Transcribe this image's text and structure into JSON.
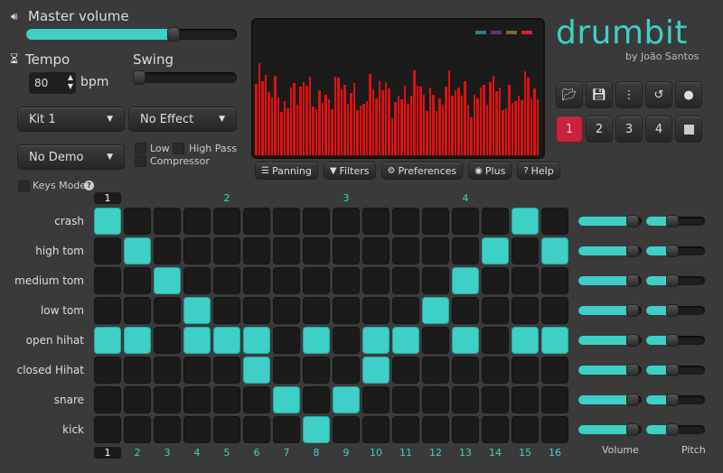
{
  "master_volume": {
    "label": "Master volume",
    "value": 0.7
  },
  "tempo": {
    "label": "Tempo",
    "value": "80",
    "unit": "bpm"
  },
  "swing": {
    "label": "Swing",
    "value": 0
  },
  "kit_select": "Kit 1",
  "effect_select": "No Effect",
  "demo_select": "No Demo",
  "filters": {
    "low": "Low",
    "high_pass": "High Pass",
    "compressor": "Compressor"
  },
  "keys_mode": "Keys Mode",
  "visualizer": {
    "legend_colors": [
      "#2e7d82",
      "#6b2f6b",
      "#6f6f2a",
      "#d42040"
    ],
    "bar_color": "#e01010"
  },
  "toolbar": [
    "Panning",
    "Filters",
    "Preferences",
    "Plus",
    "Help"
  ],
  "logo": {
    "title": "drumbit",
    "byline": "by João Santos"
  },
  "patterns": [
    "1",
    "2",
    "3",
    "4"
  ],
  "active_pattern": 0,
  "beat_markers": [
    "1",
    "2",
    "3",
    "4"
  ],
  "step_numbers": [
    "1",
    "2",
    "3",
    "4",
    "5",
    "6",
    "7",
    "8",
    "9",
    "10",
    "11",
    "12",
    "13",
    "14",
    "15",
    "16"
  ],
  "tracks": [
    {
      "name": "crash",
      "steps": [
        1,
        15
      ],
      "volume": 0.85,
      "pitch": 0.45
    },
    {
      "name": "high tom",
      "steps": [
        2,
        14,
        16
      ],
      "volume": 0.85,
      "pitch": 0.45
    },
    {
      "name": "medium tom",
      "steps": [
        3,
        13
      ],
      "volume": 0.85,
      "pitch": 0.45
    },
    {
      "name": "low tom",
      "steps": [
        4,
        12
      ],
      "volume": 0.85,
      "pitch": 0.45
    },
    {
      "name": "open hihat",
      "steps": [
        1,
        2,
        4,
        5,
        6,
        8,
        10,
        11,
        13,
        15,
        16
      ],
      "volume": 0.85,
      "pitch": 0.45
    },
    {
      "name": "closed Hihat",
      "steps": [
        6,
        10
      ],
      "volume": 0.85,
      "pitch": 0.45
    },
    {
      "name": "snare",
      "steps": [
        7,
        9
      ],
      "volume": 0.85,
      "pitch": 0.45
    },
    {
      "name": "kick",
      "steps": [
        8
      ],
      "volume": 0.85,
      "pitch": 0.45
    }
  ],
  "column_labels": {
    "volume": "Volume",
    "pitch": "Pitch"
  },
  "accent": "#3ecfc6"
}
